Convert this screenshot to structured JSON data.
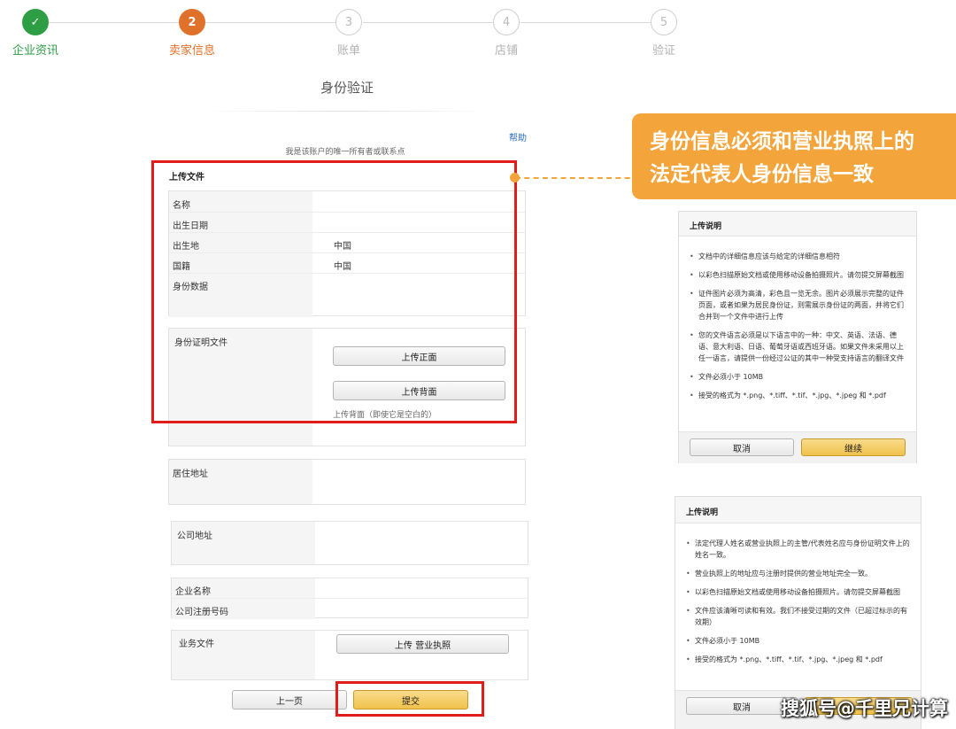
{
  "stepper": {
    "steps": [
      {
        "number": "✓",
        "label": "企业资讯",
        "state": "done"
      },
      {
        "number": "2",
        "label": "卖家信息",
        "state": "active"
      },
      {
        "number": "3",
        "label": "账单",
        "state": "pending"
      },
      {
        "number": "4",
        "label": "店铺",
        "state": "pending"
      },
      {
        "number": "5",
        "label": "验证",
        "state": "pending"
      }
    ]
  },
  "page": {
    "title": "身份验证",
    "help_link": "帮助",
    "owner_text": "我是该账户的唯一所有者或联系点"
  },
  "upload_section": {
    "title": "上传文件",
    "fields": [
      {
        "label": "名称",
        "value": ""
      },
      {
        "label": "出生日期",
        "value": ""
      },
      {
        "label": "出生地",
        "value": "中国"
      },
      {
        "label": "国籍",
        "value": "中国"
      },
      {
        "label": "身份数据",
        "value": ""
      }
    ],
    "id_doc_label": "身份证明文件",
    "upload_front": "上传正面",
    "upload_back": "上传背面",
    "back_hint": "上传背面（即使它是空白的）"
  },
  "address": {
    "residence_label": "居住地址",
    "company_address_label": "公司地址"
  },
  "company": {
    "name_label": "企业名称",
    "reg_label": "公司注册号码"
  },
  "business_doc": {
    "label": "业务文件",
    "upload_button": "上传 营业执照"
  },
  "nav": {
    "prev": "上一页",
    "submit": "提交"
  },
  "callout": {
    "line1": "身份信息必须和营业执照上的",
    "line2": "法定代表人身份信息一致",
    "color": "#f3a53c"
  },
  "panel1": {
    "title": "上传说明",
    "items": [
      "文档中的详细信息应该与给定的详细信息相符",
      "以彩色扫描原始文档或使用移动设备拍摄照片。请勿提交屏幕截图",
      "证件图片必须为高清，彩色且一览无余。图片必须展示完整的证件页面，或者如果为居民身份证，则需展示身份证的两面，并将它们合并到一个文件中进行上传",
      "您的文件语言必须是以下语言中的一种：中文、英语、法语、德语、意大利语、日语、葡萄牙语或西班牙语。如果文件未采用以上任一语言，请提供一份经过公证的其中一种受支持语言的翻译文件",
      "文件必须小于 10MB",
      "接受的格式为 *.png、*.tiff、*.tif、*.jpg、*.jpeg 和 *.pdf"
    ],
    "cancel": "取消",
    "continue": "继续"
  },
  "panel2": {
    "title": "上传说明",
    "items": [
      "法定代理人姓名或营业执照上的主管/代表姓名应与身份证明文件上的姓名一致。",
      "营业执照上的地址应与注册时提供的营业地址完全一致。",
      "以彩色扫描原始文档或使用移动设备拍摄照片。请勿提交屏幕截图",
      "文件应该清晰可读和有效。我们不接受过期的文件（已超过标示的有效期）",
      "文件必须小于 10MB",
      "接受的格式为 *.png、*.tiff、*.tif、*.jpg、*.jpeg 和 *.pdf"
    ],
    "cancel": "取消"
  },
  "watermark": "搜狐号@千里兄计算"
}
